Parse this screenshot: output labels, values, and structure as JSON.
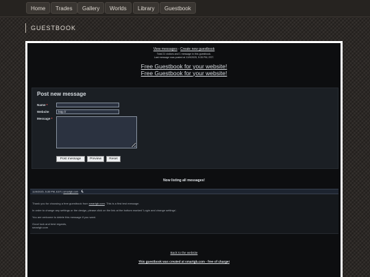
{
  "nav": {
    "items": [
      {
        "label": "Home"
      },
      {
        "label": "Trades"
      },
      {
        "label": "Gallery"
      },
      {
        "label": "Worlds"
      },
      {
        "label": "Library"
      },
      {
        "label": "Guestbook"
      }
    ]
  },
  "page": {
    "title": "GUESTBOOK"
  },
  "guestbook": {
    "view_messages": "View messages",
    "separator": " - ",
    "create_guestbook": "Create new guestbook",
    "stats_line1": "Total 21 visitors and 1 message in this guestbook.",
    "stats_line2": "Last message was posted at 11/9/2025, 5:35 PM, EST.",
    "promo_line1": "Free Guestbook for your website!",
    "promo_line2": "Free Guestbook for your website!"
  },
  "form": {
    "title": "Post new message",
    "name_label": "Name",
    "website_label": "Website",
    "message_label": "Message",
    "required_mark": "*",
    "name_value": "",
    "website_value": "http://",
    "message_value": "",
    "post_button": "Post message",
    "preview_button": "Preview",
    "reset_button": "Reset"
  },
  "listing": {
    "heading": "Now listing all messages!",
    "entry": {
      "meta": "11/9/2025, 5:35 PM, EST",
      "separator": " | ",
      "author": "smartgb.com",
      "paragraphs": [
        "In order to change any settings or the design, please click on the link at the bottom marked 'Login and change settings'.",
        "You are welcome to delete this message if you want."
      ],
      "thanks_before": "Thank you for choosing a free guestbook from ",
      "thanks_link": "smartgb.com",
      "thanks_after": ". This is a first test message.",
      "closing_line1": "Good luck and best regards,",
      "closing_line2": "smartgb.com"
    }
  },
  "footer": {
    "back_link": "Back to the website",
    "created_link": "This guestbook was created at smartgb.com - free of charge!"
  },
  "colors": {
    "page_background": "#2a2623",
    "panel_background": "#0d0e10",
    "form_background": "#1b1f24",
    "input_background": "#2b3240",
    "entry_bar": "#1d2430"
  },
  "icons": {
    "entry_icon": "moon-icon"
  }
}
